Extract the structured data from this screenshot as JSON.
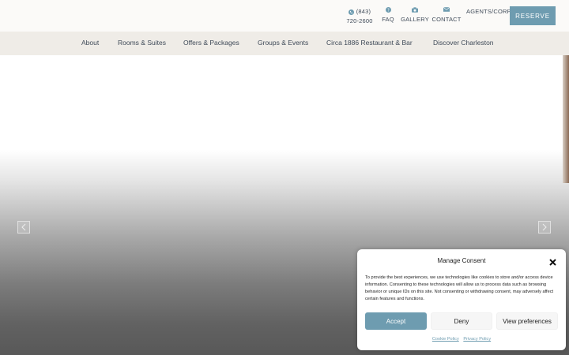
{
  "utility": {
    "phone_line1": "(843)",
    "phone_line2": "720-2600",
    "faq": "FAQ",
    "gallery": "GALLERY",
    "contact": "CONTACT",
    "agents": "AGENTS/CORP",
    "reserve": "RESERVE"
  },
  "nav": {
    "items": [
      {
        "label": "About"
      },
      {
        "label": "Rooms & Suites"
      },
      {
        "label": "Offers & Packages"
      },
      {
        "label": "Groups & Events"
      },
      {
        "label": "Circa 1886 Restaurant & Bar"
      },
      {
        "label": "Discover Charleston"
      }
    ]
  },
  "consent": {
    "title": "Manage Consent",
    "body": "To provide the best experiences, we use technologies like cookies to store and/or access device information. Consenting to these technologies will allow us to process data such as browsing behavior or unique IDs on this site. Not consenting or withdrawing consent, may adversely affect certain features and functions.",
    "accept": "Accept",
    "deny": "Deny",
    "preferences": "View preferences",
    "cookie_policy": "Cookie Policy",
    "privacy_policy": "Privacy Policy"
  },
  "colors": {
    "accent": "#6e9cb0",
    "nav_bg": "#efece7",
    "text": "#3f4a58"
  },
  "icons": [
    "phone-icon",
    "question-icon",
    "camera-icon",
    "envelope-icon",
    "chevron-left-icon",
    "chevron-right-icon",
    "close-icon"
  ]
}
